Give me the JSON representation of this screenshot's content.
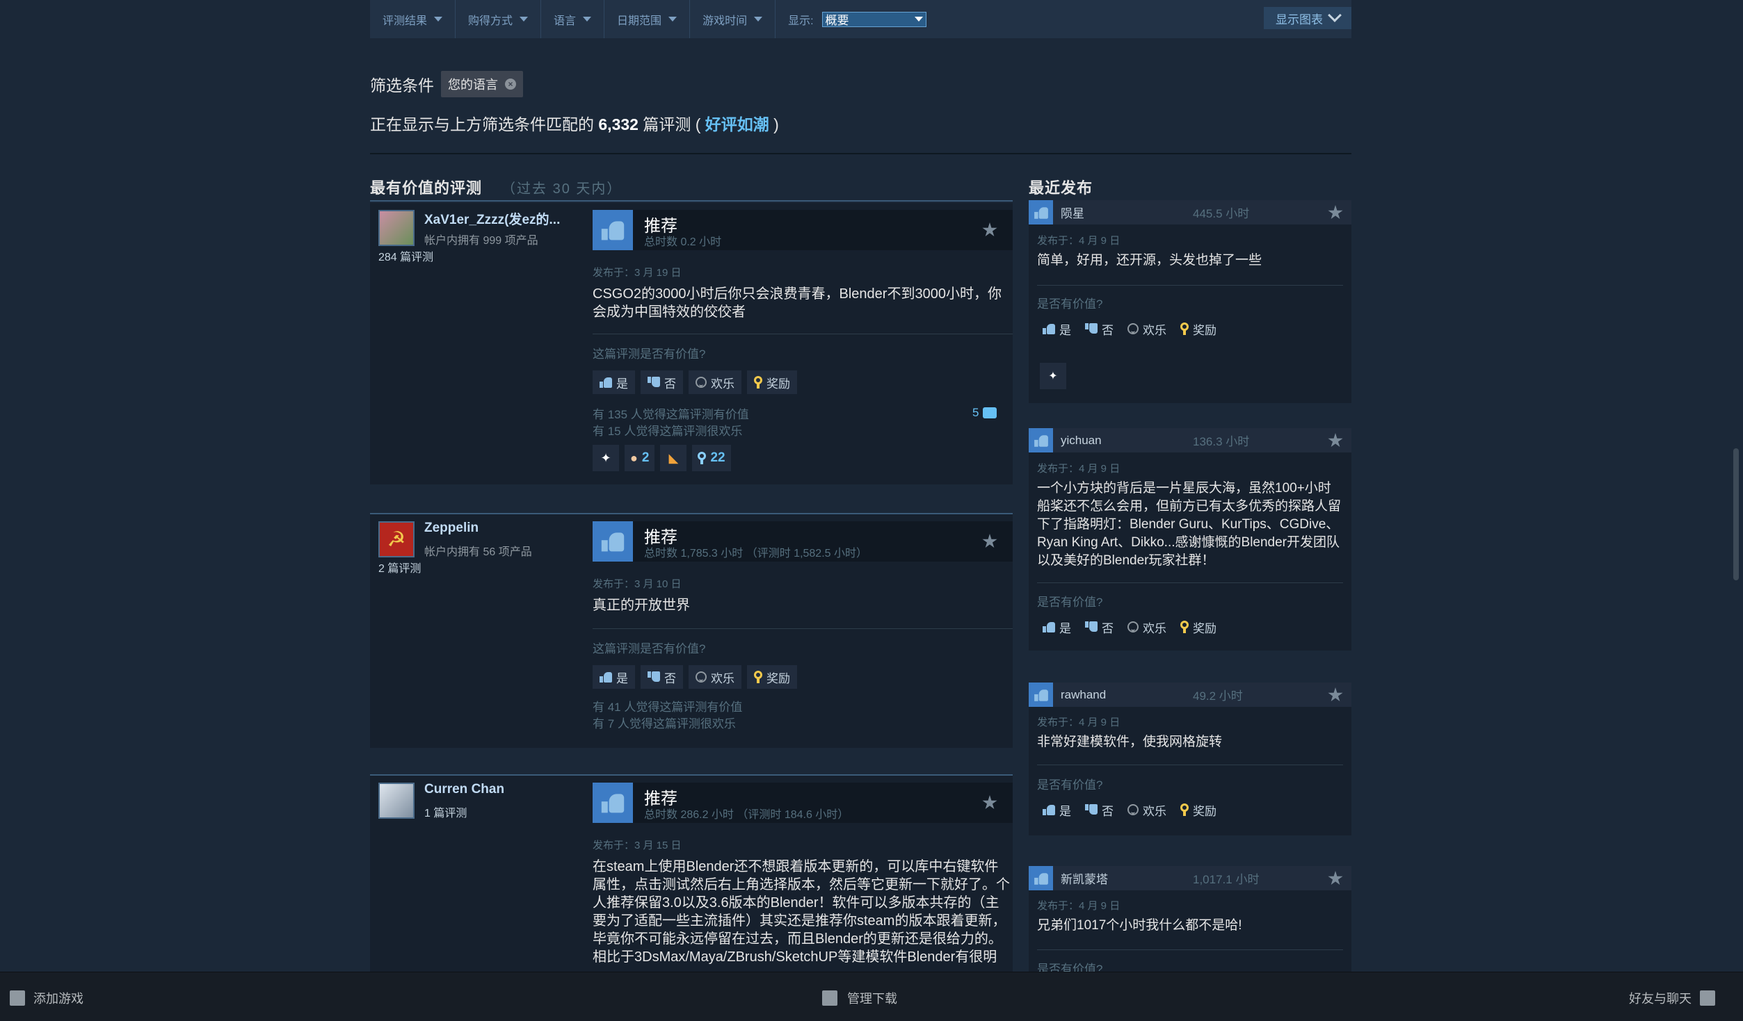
{
  "filters": {
    "items": [
      "评测结果",
      "购得方式",
      "语言",
      "日期范围",
      "游戏时间"
    ],
    "display_label": "显示:",
    "display_value": "概要",
    "chart_button": "显示图表"
  },
  "active_filter": {
    "label": "筛选条件",
    "chip": "您的语言"
  },
  "summary": {
    "prefix": "正在显示与上方筛选条件匹配的 ",
    "count": "6,332",
    "middle": " 篇评测 ( ",
    "rating": "好评如潮",
    "suffix": " )"
  },
  "helpful_section": {
    "title": "最有价值的评测",
    "subtitle": "（过去 30 天内）"
  },
  "recent_section": {
    "title": "最近发布"
  },
  "vote_labels": {
    "question": "这篇评测是否有价值?",
    "yes": "是",
    "no": "否",
    "funny": "欢乐",
    "award": "奖励"
  },
  "side_labels": {
    "question": "是否有价值?"
  },
  "reviews": [
    {
      "name": "XaV1er_Zzzz(发ez的...",
      "products": "帐户内拥有 999 项产品",
      "review_count": "284 篇评测",
      "verdict": "推荐",
      "hours": "总时数 0.2 小时",
      "posted": "发布于：3 月 19 日",
      "text": "CSGO2的3000小时后你只会浪费青春，Blender不到3000小时，你会成为中国特效的佼佼者",
      "helpful": "有 135 人觉得这篇评测有价值",
      "funny": "有 15 人觉得这篇评测很欢乐",
      "comments": "5",
      "award_counts": [
        "2",
        "22"
      ]
    },
    {
      "name": "Zeppelin",
      "products": "帐户内拥有 56 项产品",
      "review_count": "2 篇评测",
      "verdict": "推荐",
      "hours": "总时数 1,785.3 小时 （评测时 1,582.5 小时）",
      "posted": "发布于：3 月 10 日",
      "text": "真正的开放世界",
      "helpful": "有 41 人觉得这篇评测有价值",
      "funny": "有 7 人觉得这篇评测很欢乐"
    },
    {
      "name": "Curren Chan",
      "review_count": "1 篇评测",
      "verdict": "推荐",
      "hours": "总时数 286.2 小时 （评测时 184.6 小时）",
      "posted": "发布于：3 月 15 日",
      "text": "在steam上使用Blender还不想跟着版本更新的，可以库中右键软件属性，点击测试然后右上角选择版本，然后等它更新一下就好了。个人推荐保留3.0以及3.6版本的Blender！软件可以多版本共存的（主要为了适配一些主流插件）其实还是推荐你steam的版本跟着更新，毕竟你不可能永远停留在过去，而且Blender的更新还是很给力的。相比于3DsMax/Maya/ZBrush/SketchUP等建模软件Blender有很明"
    }
  ],
  "recent": [
    {
      "name": "陨星",
      "hours": "445.5 小时",
      "posted": "发布于：4 月 9 日",
      "text": "简单，好用，还开源，头发也掉了一些"
    },
    {
      "name": "yichuan",
      "hours": "136.3 小时",
      "posted": "发布于：4 月 9 日",
      "text": "一个小方块的背后是一片星辰大海，虽然100+小时船桨还不怎么会用，但前方已有太多优秀的探路人留下了指路明灯：Blender Guru、KurTips、CGDive、Ryan King Art、Dikko...感谢慷慨的Blender开发团队以及美好的Blender玩家社群！"
    },
    {
      "name": "rawhand",
      "hours": "49.2 小时",
      "posted": "发布于：4 月 9 日",
      "text": "非常好建模软件，使我网格旋转"
    },
    {
      "name": "新凯蒙塔",
      "hours": "1,017.1 小时",
      "posted": "发布于：4 月 9 日",
      "text": "兄弟们1017个小时我什么都不是哈!"
    }
  ],
  "bottom_bar": {
    "add_game": "添加游戏",
    "downloads": "管理下载",
    "friends": "好友与聊天"
  }
}
